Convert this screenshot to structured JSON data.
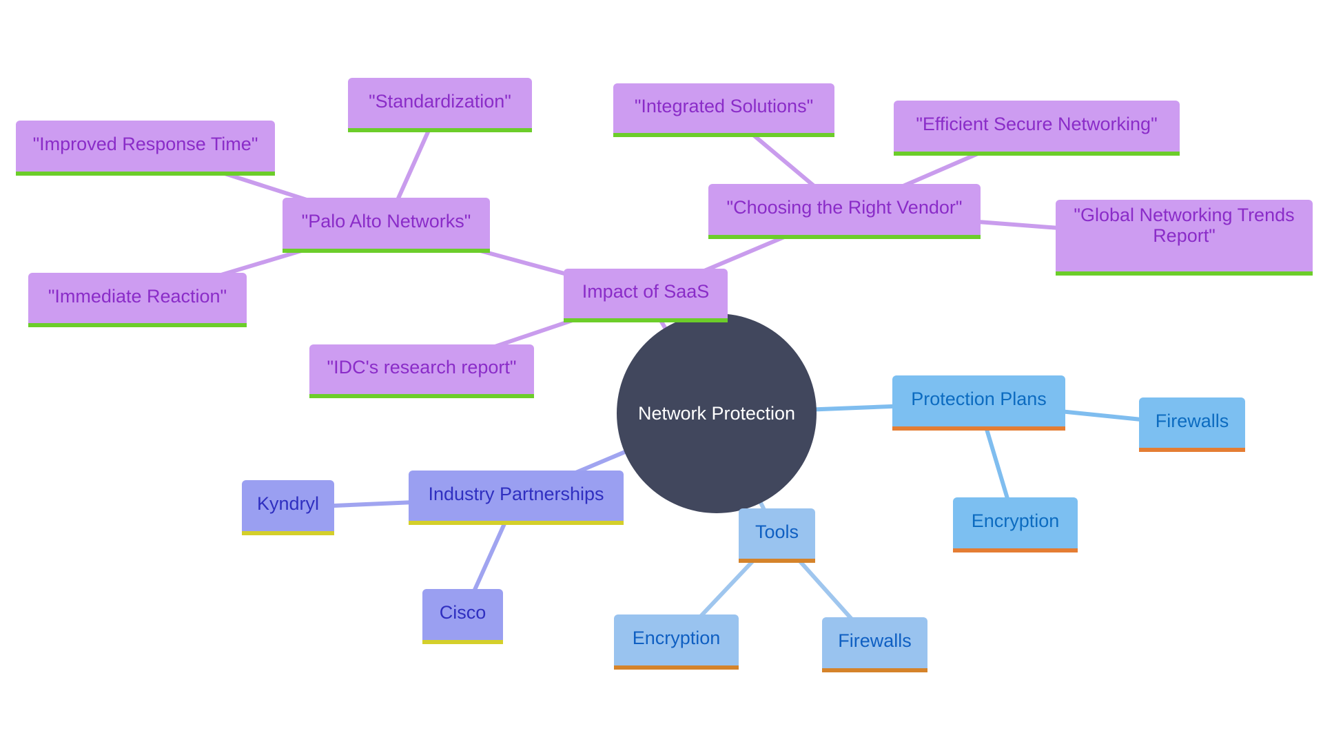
{
  "diagram": {
    "type": "mindmap",
    "root": {
      "id": "root",
      "label": "Network Protection",
      "color": "#41475d"
    },
    "palette": {
      "purple": {
        "fill": "#cd9cf1",
        "text": "#8a2cc8",
        "accent": "#6ccd2a",
        "edge": "#c99ced"
      },
      "indigo": {
        "fill": "#9a9ff1",
        "text": "#2f2fc0",
        "accent": "#d4cf2a",
        "edge": "#a0a4f0"
      },
      "blue": {
        "fill": "#7cbff1",
        "text": "#0c6bc0",
        "accent": "#e47d33",
        "edge": "#7fbdef"
      },
      "lightblue": {
        "fill": "#99c3ef",
        "text": "#0f5fc2",
        "accent": "#d5832a",
        "edge": "#9fc6ee"
      }
    },
    "nodes": [
      {
        "id": "saas",
        "label": "Impact of SaaS",
        "parent": "root",
        "theme": "purple"
      },
      {
        "id": "vendor",
        "label": "\"Choosing the Right Vendor\"",
        "parent": "saas",
        "theme": "purple"
      },
      {
        "id": "integrated",
        "label": "\"Integrated Solutions\"",
        "parent": "vendor",
        "theme": "purple"
      },
      {
        "id": "efficient",
        "label": "\"Efficient Secure Networking\"",
        "parent": "vendor",
        "theme": "purple"
      },
      {
        "id": "global",
        "label": "\"Global Networking Trends Report\"",
        "parent": "vendor",
        "theme": "purple"
      },
      {
        "id": "palo",
        "label": "\"Palo Alto Networks\"",
        "parent": "saas",
        "theme": "purple"
      },
      {
        "id": "standard",
        "label": "\"Standardization\"",
        "parent": "palo",
        "theme": "purple"
      },
      {
        "id": "improved",
        "label": "\"Improved Response Time\"",
        "parent": "palo",
        "theme": "purple"
      },
      {
        "id": "immediate",
        "label": "\"Immediate Reaction\"",
        "parent": "palo",
        "theme": "purple"
      },
      {
        "id": "idc",
        "label": "\"IDC's research report\"",
        "parent": "saas",
        "theme": "purple"
      },
      {
        "id": "plans",
        "label": "Protection Plans",
        "parent": "root",
        "theme": "blue"
      },
      {
        "id": "plans_fw",
        "label": "Firewalls",
        "parent": "plans",
        "theme": "blue"
      },
      {
        "id": "plans_enc",
        "label": "Encryption",
        "parent": "plans",
        "theme": "blue"
      },
      {
        "id": "tools",
        "label": "Tools",
        "parent": "root",
        "theme": "lightblue"
      },
      {
        "id": "tools_enc",
        "label": "Encryption",
        "parent": "tools",
        "theme": "lightblue"
      },
      {
        "id": "tools_fw",
        "label": "Firewalls",
        "parent": "tools",
        "theme": "lightblue"
      },
      {
        "id": "partners",
        "label": "Industry Partnerships",
        "parent": "root",
        "theme": "indigo"
      },
      {
        "id": "kyndryl",
        "label": "Kyndryl",
        "parent": "partners",
        "theme": "indigo"
      },
      {
        "id": "cisco",
        "label": "Cisco",
        "parent": "partners",
        "theme": "indigo"
      }
    ]
  }
}
